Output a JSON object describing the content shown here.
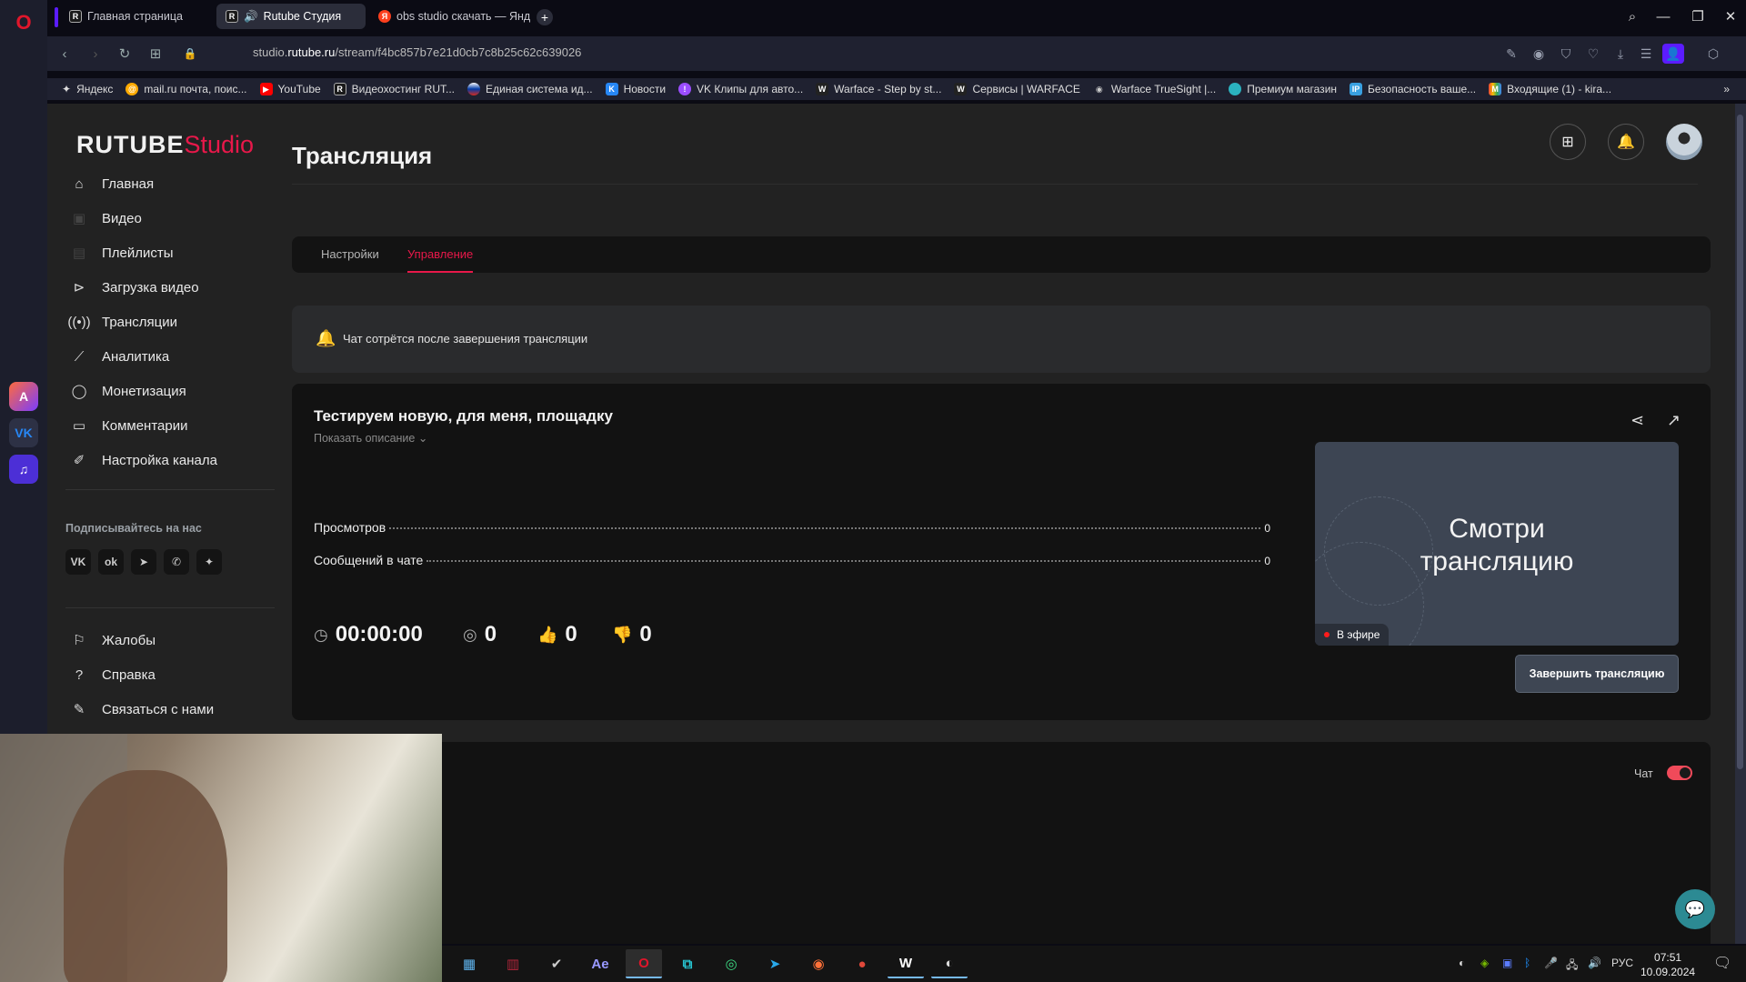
{
  "browser": {
    "tabs": [
      {
        "label": "Главная страница",
        "favicon": "R",
        "active": false
      },
      {
        "label": "Rutube Студия",
        "favicon": "R",
        "active": true,
        "audio": true
      },
      {
        "label": "obs studio скачать — Янд",
        "favicon": "Я",
        "active": false
      }
    ],
    "url_prefix": "studio.",
    "url_domain": "rutube.ru",
    "url_path": "/stream/f4bc857b7e21d0cb7c8b25c62c639026",
    "bookmarks": [
      "Яндекс",
      "mail.ru почта, поис...",
      "YouTube",
      "Видеохостинг RUT...",
      "Единая система ид...",
      "Новости",
      "VK Клипы для авто...",
      "Warface - Step by st...",
      "Сервисы | WARFACE",
      "Warface TrueSight |...",
      "Премиум магазин",
      "Безопасность ваше...",
      "Входящие (1) - kira..."
    ]
  },
  "app": {
    "brand_main": "RUTUBE",
    "brand_sub": "Studio",
    "nav": [
      {
        "label": "Главная",
        "icon": "home-icon"
      },
      {
        "label": "Видео",
        "icon": "video-icon"
      },
      {
        "label": "Плейлисты",
        "icon": "playlist-icon"
      },
      {
        "label": "Загрузка видео",
        "icon": "upload-video-icon"
      },
      {
        "label": "Трансляции",
        "icon": "broadcast-icon"
      },
      {
        "label": "Аналитика",
        "icon": "analytics-icon"
      },
      {
        "label": "Монетизация",
        "icon": "monetization-icon"
      },
      {
        "label": "Комментарии",
        "icon": "comments-icon"
      },
      {
        "label": "Настройка канала",
        "icon": "channel-settings-icon"
      }
    ],
    "follow_label": "Подписывайтесь на нас",
    "socials": [
      "vk",
      "ok",
      "telegram",
      "viber",
      "dzen"
    ],
    "nav_bottom": [
      {
        "label": "Жалобы",
        "icon": "flag-icon"
      },
      {
        "label": "Справка",
        "icon": "help-icon"
      },
      {
        "label": "Связаться с нами",
        "icon": "contact-icon"
      }
    ]
  },
  "page": {
    "title": "Трансляция",
    "tabs": [
      {
        "label": "Настройки",
        "active": false
      },
      {
        "label": "Управление",
        "active": true
      }
    ],
    "notice": "Чат сотрётся после завершения трансляции",
    "stream": {
      "title": "Тестируем новую, для меня, площадку",
      "show_description": "Показать описание",
      "stats": [
        {
          "label": "Просмотров",
          "value": "0"
        },
        {
          "label": "Сообщений в чате",
          "value": "0"
        }
      ],
      "duration": "00:00:00",
      "viewers": "0",
      "likes": "0",
      "dislikes": "0",
      "preview_text": "Смотри трансляцию",
      "live_badge": "В эфире",
      "end_button": "Завершить трансляцию"
    },
    "chat": {
      "label": "Чат",
      "enabled": true
    }
  },
  "taskbar": {
    "apps": [
      "explorer",
      "winrar",
      "checkmark-app",
      "after-effects",
      "opera",
      "capcut",
      "android-app",
      "telegram",
      "firefox",
      "planet-app",
      "warface-app",
      "obs-studio"
    ],
    "language": "РУС",
    "time": "07:51",
    "date": "10.09.2024"
  },
  "colors": {
    "accent": "#e8184a",
    "toggle_on": "#f04a5a",
    "fab": "#2c8a93",
    "browser_accent": "#5b1cff"
  }
}
